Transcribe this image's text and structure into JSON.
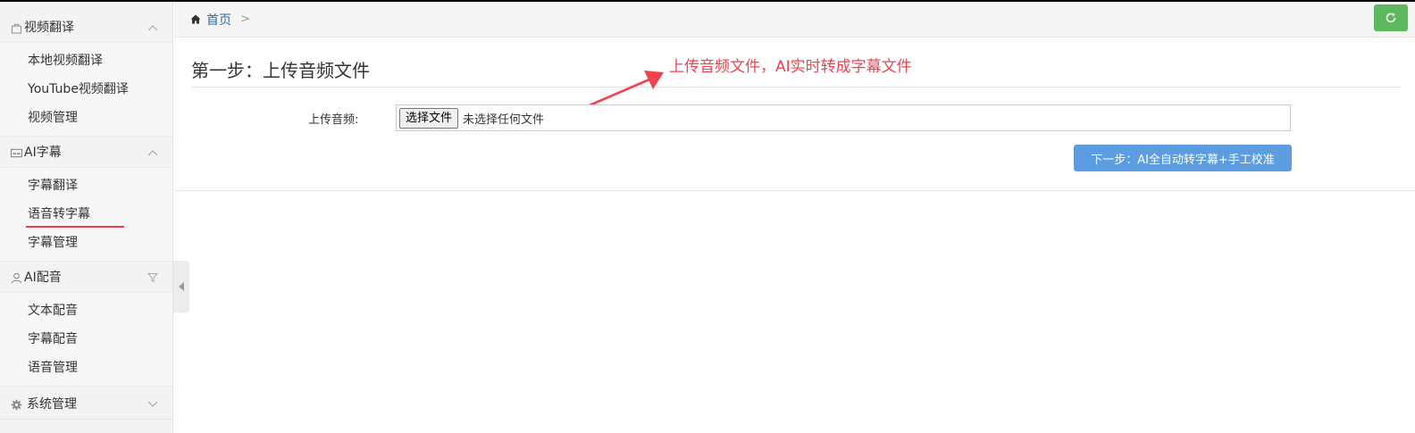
{
  "sidebar": {
    "groups": [
      {
        "title": "视频翻译",
        "icon": "video-bag-icon",
        "items": [
          {
            "label": "本地视频翻译"
          },
          {
            "label": "YouTube视频翻译"
          },
          {
            "label": "视频管理"
          }
        ]
      },
      {
        "title": "AI字幕",
        "icon": "subtitle-screen-icon",
        "items": [
          {
            "label": "字幕翻译"
          },
          {
            "label": "语音转字幕",
            "active": true
          },
          {
            "label": "字幕管理"
          }
        ]
      },
      {
        "title": "AI配音",
        "icon": "user-voice-icon",
        "items": [
          {
            "label": "文本配音"
          },
          {
            "label": "字幕配音"
          },
          {
            "label": "语音管理"
          }
        ]
      },
      {
        "title": "系统管理",
        "icon": "gear-icon",
        "items": []
      }
    ]
  },
  "breadcrumb": {
    "home": "首页",
    "separator": ">"
  },
  "page": {
    "step_title": "第一步：上传音频文件",
    "annotation": "上传音频文件，AI实时转成字幕文件",
    "upload_label": "上传音频:",
    "file_button": "选择文件",
    "file_status": "未选择任何文件",
    "next_button": "下一步：AI全自动转字幕+手工校准"
  },
  "colors": {
    "accent_blue": "#5b9de0",
    "refresh_green": "#5cb85c",
    "annotation_red": "#f0434d"
  }
}
